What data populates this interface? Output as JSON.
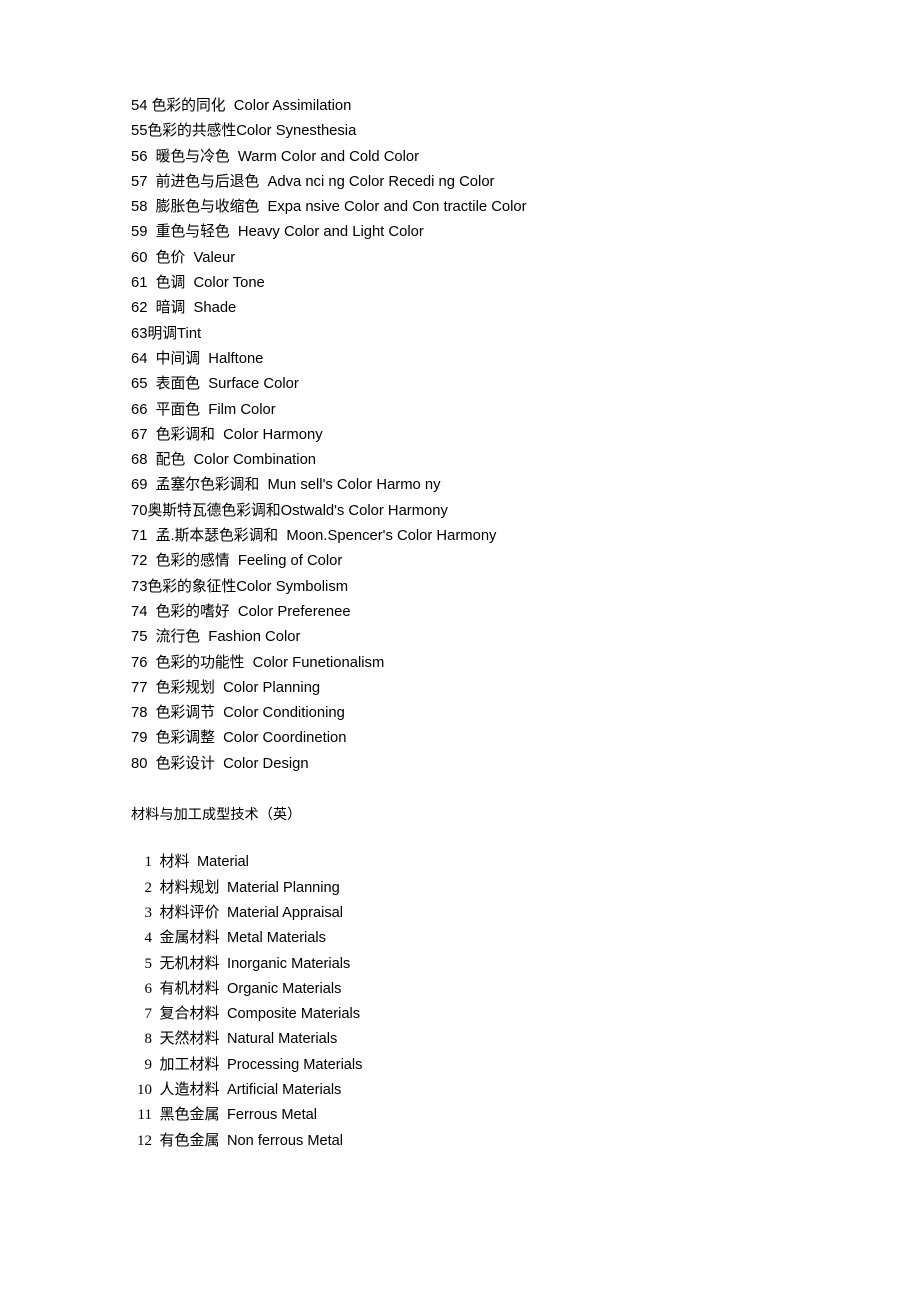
{
  "document": {
    "background_color": "#ffffff",
    "text_color": "#000000"
  },
  "sections": [
    {
      "id": "color-terms",
      "heading": null,
      "entries": [
        {
          "num": "54",
          "zh": "色彩的同化",
          "en": "Color Assimilation",
          "line": "54 色彩的同化  Color Assimilation"
        },
        {
          "num": "55",
          "zh": "色彩的共感性",
          "en": "Color Synesthesia",
          "line": "55色彩的共感性Color Synesthesia"
        },
        {
          "num": "56",
          "zh": "暖色与冷色",
          "en": "Warm Color and Cold Color",
          "line": "56  暖色与冷色  Warm Color and Cold Color"
        },
        {
          "num": "57",
          "zh": "前进色与后退色",
          "en": "Adva nci ng Color Recedi ng Color",
          "line": "57  前进色与后退色  Adva nci ng Color Recedi ng Color"
        },
        {
          "num": "58",
          "zh": "膨胀色与收缩色",
          "en": "Expa nsive Color and Con tractile Color",
          "line": "58  膨胀色与收缩色  Expa nsive Color and Con tractile Color"
        },
        {
          "num": "59",
          "zh": "重色与轻色",
          "en": "Heavy Color and Light Color",
          "line": "59  重色与轻色  Heavy Color and Light Color"
        },
        {
          "num": "60",
          "zh": "色价",
          "en": "Valeur",
          "line": "60  色价  Valeur"
        },
        {
          "num": "61",
          "zh": "色调",
          "en": "Color Tone",
          "line": "61  色调  Color Tone"
        },
        {
          "num": "62",
          "zh": "暗调",
          "en": "Shade",
          "line": "62  暗调  Shade"
        },
        {
          "num": "63",
          "zh": "明调",
          "en": "Tint",
          "line": "63明调Tint"
        },
        {
          "num": "64",
          "zh": "中间调",
          "en": "Halftone",
          "line": "64  中间调  Halftone"
        },
        {
          "num": "65",
          "zh": "表面色",
          "en": "Surface Color",
          "line": "65  表面色  Surface Color"
        },
        {
          "num": "66",
          "zh": "平面色",
          "en": "Film Color",
          "line": "66  平面色  Film Color"
        },
        {
          "num": "67",
          "zh": "色彩调和",
          "en": "Color Harmony",
          "line": "67  色彩调和  Color Harmony"
        },
        {
          "num": "68",
          "zh": "配色",
          "en": "Color Combination",
          "line": "68  配色  Color Combination"
        },
        {
          "num": "69",
          "zh": "孟塞尔色彩调和",
          "en": "Mun sell's Color Harmo ny",
          "line": "69  孟塞尔色彩调和  Mun sell's Color Harmo ny"
        },
        {
          "num": "70",
          "zh": "奥斯特瓦德色彩调和",
          "en": "Ostwald's Color Harmony",
          "line": "70奥斯特瓦德色彩调和Ostwald's Color Harmony"
        },
        {
          "num": "71",
          "zh": "孟.斯本瑟色彩调和",
          "en": "Moon.Spencer's Color Harmony",
          "line": "71  孟.斯本瑟色彩调和  Moon.Spencer's Color Harmony"
        },
        {
          "num": "72",
          "zh": "色彩的感情",
          "en": "Feeling of Color",
          "line": "72  色彩的感情  Feeling of Color"
        },
        {
          "num": "73",
          "zh": "色彩的象征性",
          "en": "Color Symbolism",
          "line": "73色彩的象征性Color Symbolism"
        },
        {
          "num": "74",
          "zh": "色彩的嗜好",
          "en": "Color Preferenee",
          "line": "74  色彩的嗜好  Color Preferenee"
        },
        {
          "num": "75",
          "zh": "流行色",
          "en": "Fashion Color",
          "line": "75  流行色  Fashion Color"
        },
        {
          "num": "76",
          "zh": "色彩的功能性",
          "en": "Color Funetionalism",
          "line": "76  色彩的功能性  Color Funetionalism"
        },
        {
          "num": "77",
          "zh": "色彩规划",
          "en": "Color Planning",
          "line": "77  色彩规划  Color Planning"
        },
        {
          "num": "78",
          "zh": "色彩调节",
          "en": "Color Conditioning",
          "line": "78  色彩调节  Color Conditioning"
        },
        {
          "num": "79",
          "zh": "色彩调整",
          "en": "Color Coordinetion",
          "line": "79  色彩调整  Color Coordinetion"
        },
        {
          "num": "80",
          "zh": "色彩设计",
          "en": "Color Design",
          "line": "80  色彩设计  Color Design"
        }
      ]
    },
    {
      "id": "material-terms",
      "heading": "材料与加工成型技术（英）",
      "entries": [
        {
          "num": "1",
          "zh": "材料",
          "en": "Material"
        },
        {
          "num": "2",
          "zh": "材料规划",
          "en": "Material Planning"
        },
        {
          "num": "3",
          "zh": "材料评价",
          "en": "Material Appraisal"
        },
        {
          "num": "4",
          "zh": "金属材料",
          "en": "Metal Materials"
        },
        {
          "num": "5",
          "zh": "无机材料",
          "en": "Inorganic Materials"
        },
        {
          "num": "6",
          "zh": "有机材料",
          "en": "Organic Materials"
        },
        {
          "num": "7",
          "zh": "复合材料",
          "en": "Composite Materials"
        },
        {
          "num": "8",
          "zh": "天然材料",
          "en": "Natural Materials"
        },
        {
          "num": "9",
          "zh": "加工材料",
          "en": "Processing Materials"
        },
        {
          "num": "10",
          "zh": "人造材料",
          "en": "Artificial Materials"
        },
        {
          "num": "11",
          "zh": "黑色金属",
          "en": "Ferrous Metal"
        },
        {
          "num": "12",
          "zh": "有色金属",
          "en": "Non ferrous Metal"
        }
      ]
    }
  ]
}
